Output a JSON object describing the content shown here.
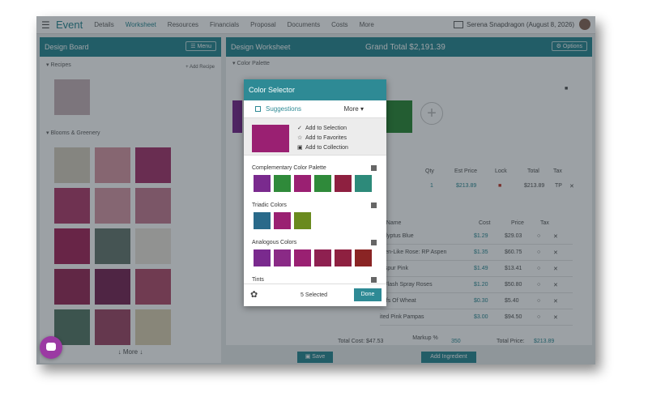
{
  "topnav": {
    "brand": "Event",
    "items": [
      "Details",
      "Worksheet",
      "Resources",
      "Financials",
      "Proposal",
      "Documents",
      "Costs",
      "More"
    ],
    "user": "Serena Snapdragon (August 8, 2026)"
  },
  "left": {
    "title": "Design Board",
    "menu_label": "Menu",
    "recipes_label": "Recipes",
    "add_recipe": "Add Recipe",
    "blooms_label": "Blooms & Greenery",
    "more_label": "More"
  },
  "right": {
    "title": "Design Worksheet",
    "grand_total": "Grand Total $2,191.39",
    "options_label": "Options",
    "palette_label": "Color Palette",
    "headers": {
      "qty": "Qty",
      "est_price": "Est Price",
      "lock": "Lock",
      "total": "Total",
      "tax": "Tax"
    },
    "row": {
      "qty": "1",
      "est_price": "$213.89",
      "total": "$213.89",
      "tax": "TP"
    },
    "ing_headers": {
      "name": "m Name",
      "cost": "Cost",
      "price": "Price",
      "tax": "Tax"
    },
    "ingredients": [
      {
        "name": "calyptus Blue",
        "cost": "$1.29",
        "price": "$29.03"
      },
      {
        "name": "rden-Like Rose: RP Aspen",
        "cost": "$1.35",
        "price": "$60.75"
      },
      {
        "name": "rkspur Pink",
        "cost": "$1.49",
        "price": "$13.41"
      },
      {
        "name": "k Flash Spray Roses",
        "cost": "$1.20",
        "price": "$50.80"
      },
      {
        "name": "eafs Of Wheat",
        "cost": "$0.30",
        "price": "$5.40"
      },
      {
        "name": "ited Pink Pampas",
        "cost": "$3.00",
        "price": "$94.50"
      }
    ],
    "total_cost": "Total Cost: $47.53",
    "markup_label": "Markup %",
    "markup_value": "350",
    "total_price_label": "Total Price:",
    "total_price_value": "$213.89",
    "add_ingredient": "Add Ingredient",
    "save": "Save"
  },
  "modal": {
    "title": "Color Selector",
    "tab_suggestions": "Suggestions",
    "tab_more": "More",
    "current_color": "#9a2072",
    "actions": [
      "Add to Selection",
      "Add to Favorites",
      "Add to Collection"
    ],
    "palettes": [
      {
        "title": "Complementary Color Palette",
        "colors": [
          "#7a2a8e",
          "#2f8a3a",
          "#9a2072",
          "#2f8a3a",
          "#8e2040",
          "#2d8a7a"
        ]
      },
      {
        "title": "Triadic Colors",
        "colors": [
          "#2a6a8a",
          "#9a2072",
          "#6a8a1e"
        ]
      },
      {
        "title": "Analogous Colors",
        "colors": [
          "#7a2a8e",
          "#8a2a86",
          "#9a2072",
          "#8e2050",
          "#8e2040",
          "#8a2424"
        ]
      },
      {
        "title": "Tints",
        "colors": []
      }
    ],
    "selected_count": "5 Selected",
    "done": "Done"
  },
  "colors": {
    "accent": "#2e8a95",
    "chat": "#9b3aa3"
  }
}
